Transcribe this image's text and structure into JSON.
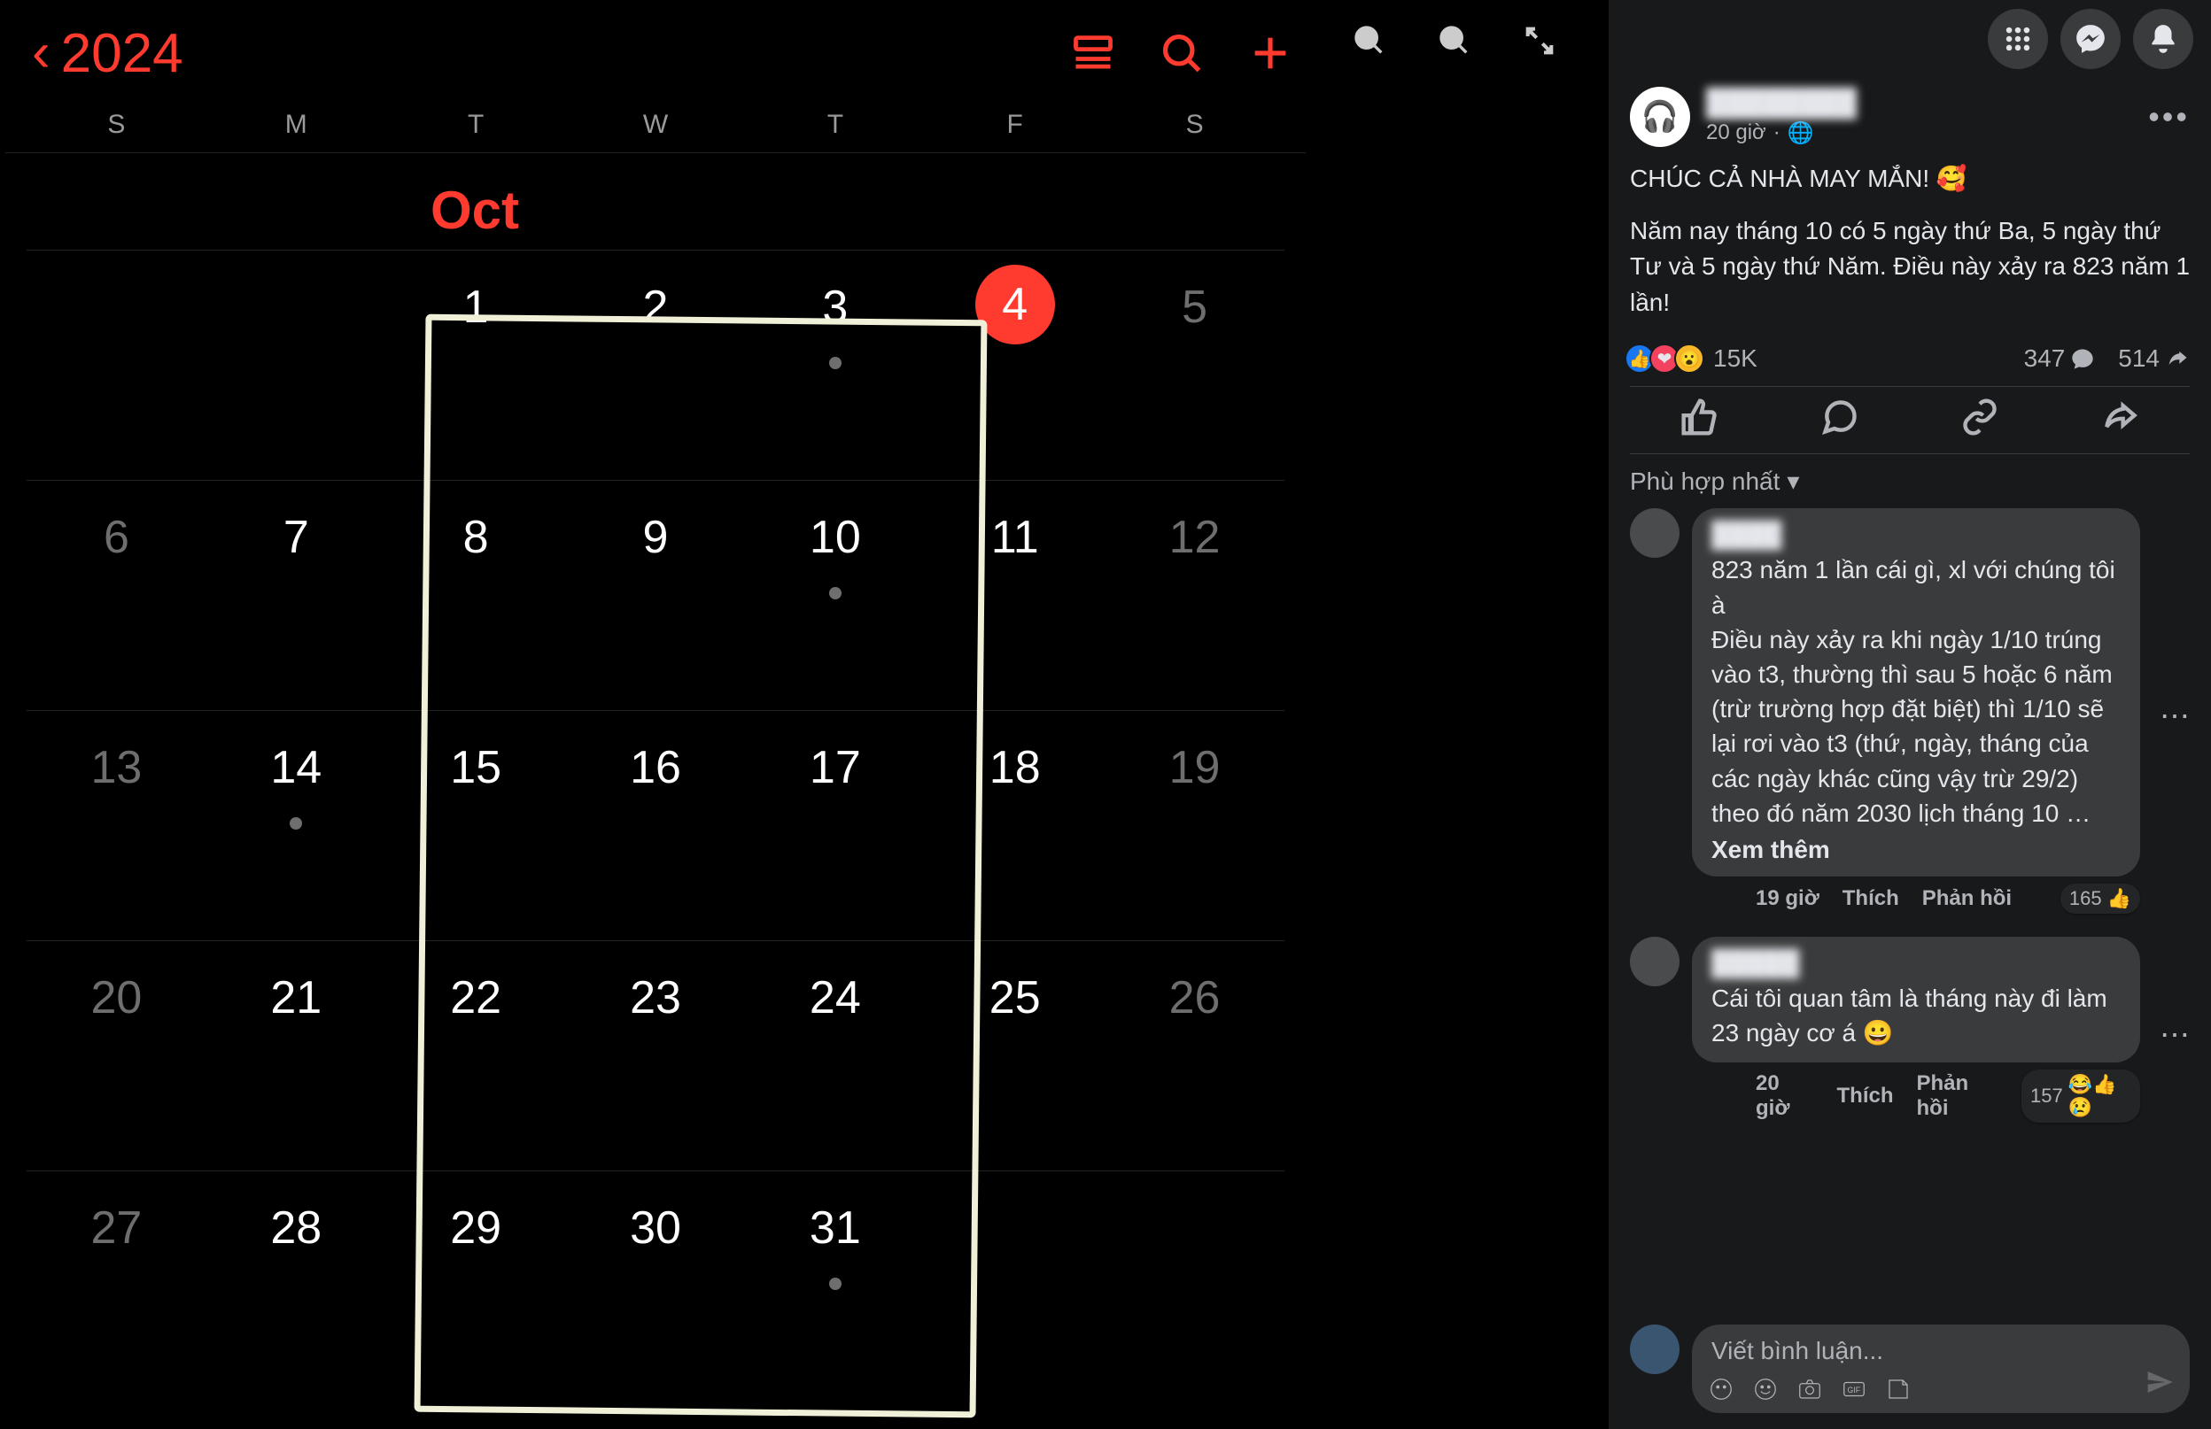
{
  "calendar": {
    "year_label": "2024",
    "month_label": "Oct",
    "weekdays": [
      "S",
      "M",
      "T",
      "W",
      "T",
      "F",
      "S"
    ],
    "weeks": [
      [
        null,
        null,
        {
          "d": 1
        },
        {
          "d": 2
        },
        {
          "d": 3,
          "dot": true
        },
        {
          "d": 4,
          "today": true
        },
        {
          "d": 5,
          "dim": true
        }
      ],
      [
        {
          "d": 6,
          "dim": true
        },
        {
          "d": 7
        },
        {
          "d": 8
        },
        {
          "d": 9
        },
        {
          "d": 10,
          "dot": true
        },
        {
          "d": 11
        },
        {
          "d": 12,
          "dim": true
        }
      ],
      [
        {
          "d": 13,
          "dim": true
        },
        {
          "d": 14,
          "dot": true
        },
        {
          "d": 15
        },
        {
          "d": 16
        },
        {
          "d": 17
        },
        {
          "d": 18
        },
        {
          "d": 19,
          "dim": true
        }
      ],
      [
        {
          "d": 20,
          "dim": true
        },
        {
          "d": 21
        },
        {
          "d": 22
        },
        {
          "d": 23
        },
        {
          "d": 24
        },
        {
          "d": 25
        },
        {
          "d": 26,
          "dim": true
        }
      ],
      [
        {
          "d": 27,
          "dim": true
        },
        {
          "d": 28
        },
        {
          "d": 29
        },
        {
          "d": 30
        },
        {
          "d": 31,
          "dot": true
        },
        null,
        null
      ]
    ]
  },
  "fb": {
    "post": {
      "author": "████████",
      "time": "20 giờ",
      "text_line1": "CHÚC CẢ NHÀ MAY MẮN! 🥰",
      "text_body": "Năm nay tháng 10 có 5 ngày thứ Ba, 5 ngày thứ Tư và 5 ngày thứ Năm. Điều này xảy ra 823 năm 1 lần!",
      "react_count": "15K",
      "comment_count": "347",
      "share_count": "514"
    },
    "sort_label": "Phù hợp nhất",
    "comments": [
      {
        "name": "████",
        "text": "823 năm 1 lần cái gì, xl với chúng tôi à\nĐiều này xảy ra khi ngày 1/10 trúng vào t3, thường thì sau 5 hoặc 6 năm (trừ trường hợp đặt biệt) thì 1/10 sẽ lại rơi vào t3 (thứ, ngày, tháng của các ngày khác cũng vậy trừ 29/2)\ntheo đó năm 2030 lịch tháng 10 …",
        "see_more": "Xem thêm",
        "time": "19 giờ",
        "like_label": "Thích",
        "reply_label": "Phản hồi",
        "react_count": "165",
        "react_emoji": "👍"
      },
      {
        "name": "█████",
        "text": "Cái tôi quan tâm là tháng này đi làm 23 ngày cơ á 😀",
        "time": "20 giờ",
        "like_label": "Thích",
        "reply_label": "Phản hồi",
        "react_count": "157",
        "react_emoji": "😂👍😢"
      }
    ],
    "comment_placeholder": "Viết bình luận..."
  }
}
